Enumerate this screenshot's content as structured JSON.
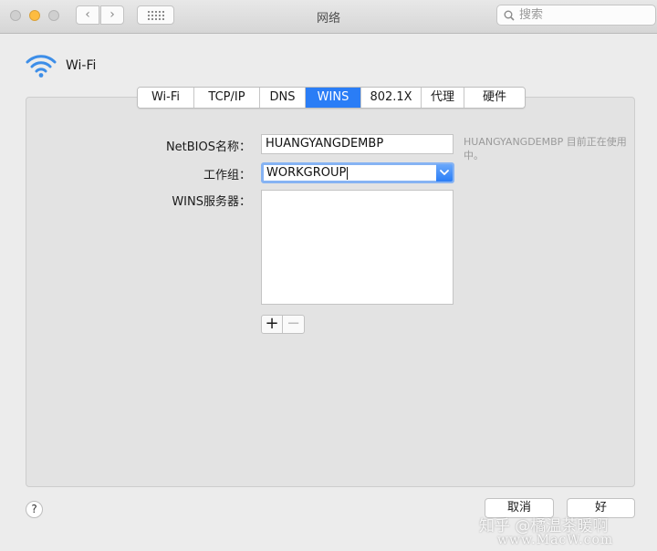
{
  "window": {
    "title": "网络"
  },
  "toolbar": {
    "back_glyph": "‹",
    "forward_glyph": "›",
    "search_placeholder": "搜索"
  },
  "header": {
    "service_name": "Wi-Fi"
  },
  "tabs": [
    {
      "label": "Wi-Fi",
      "active": false
    },
    {
      "label": "TCP/IP",
      "active": false
    },
    {
      "label": "DNS",
      "active": false
    },
    {
      "label": "WINS",
      "active": true
    },
    {
      "label": "802.1X",
      "active": false
    },
    {
      "label": "代理",
      "active": false
    },
    {
      "label": "硬件",
      "active": false
    }
  ],
  "form": {
    "netbios_label": "NetBIOS名称：",
    "netbios_value": "HUANGYANGDEMBP",
    "netbios_hint": "HUANGYANGDEMBP 目前正在使用中。",
    "workgroup_label": "工作组：",
    "workgroup_value": "WORKGROUP",
    "wins_label": "WINS服务器：",
    "wins_servers": [],
    "add_glyph": "+",
    "remove_glyph": "−"
  },
  "footer": {
    "help_glyph": "?",
    "cancel_label": "取消",
    "ok_label": "好"
  },
  "watermark": {
    "line1": "知乎 @橘温茶暖啊",
    "line2": "www.MacW.com"
  },
  "colors": {
    "accent": "#2a7df6",
    "wifi_icon": "#3d8ee8",
    "focus_ring": "#86b3f3"
  }
}
